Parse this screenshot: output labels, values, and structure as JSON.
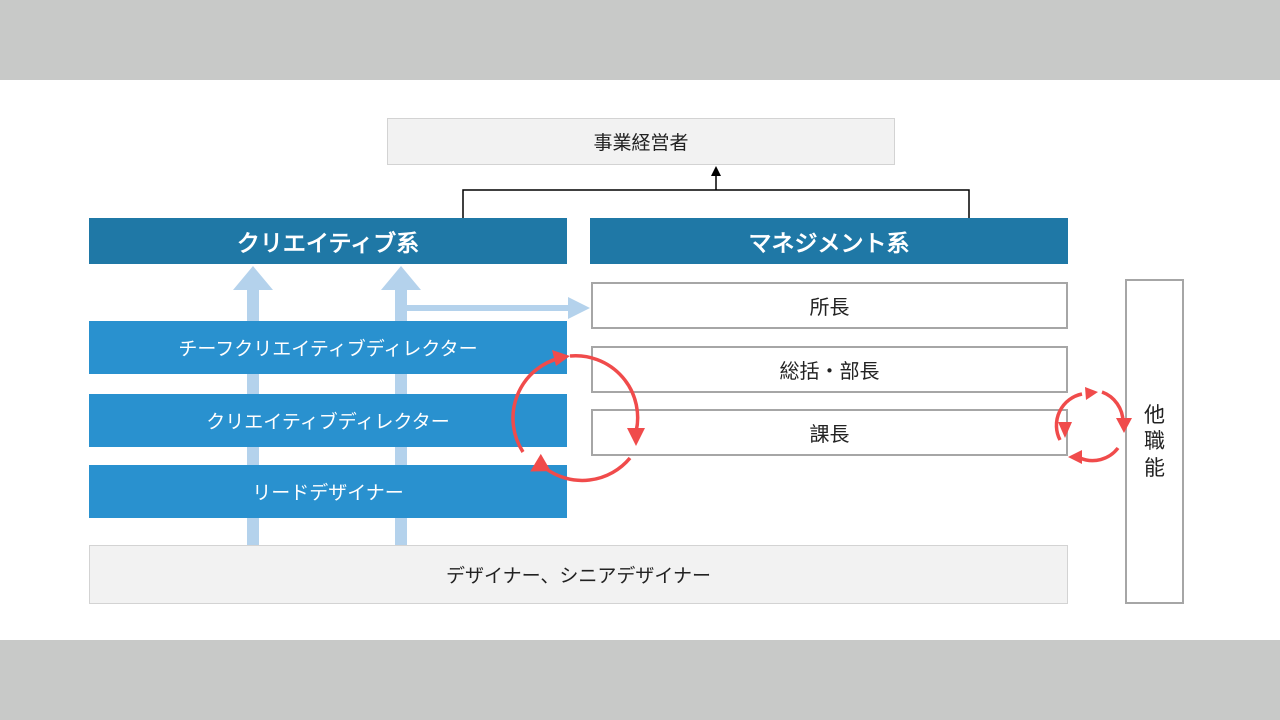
{
  "top": {
    "label": "事業経営者"
  },
  "creative": {
    "header": "クリエイティブ系",
    "roles": [
      "チーフクリエイティブディレクター",
      "クリエイティブディレクター",
      "リードデザイナー"
    ]
  },
  "management": {
    "header": "マネジメント系",
    "roles": [
      "所長",
      "総括・部長",
      "課長"
    ]
  },
  "base": {
    "label": "デザイナー、シニアデザイナー"
  },
  "other": {
    "chars": [
      "他",
      "職",
      "能"
    ]
  },
  "colors": {
    "header_blue": "#1f78a6",
    "role_blue": "#2991cf",
    "arrow_light_blue": "#b4d2ec",
    "cycle_red": "#f04b4b",
    "box_gray": "#f2f2f2",
    "border_gray": "#a6a6a6"
  }
}
